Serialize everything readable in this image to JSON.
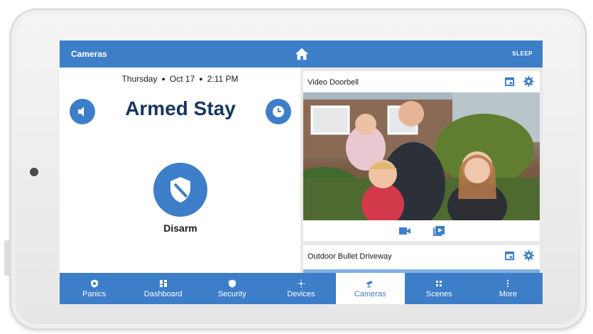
{
  "topbar": {
    "title": "Cameras",
    "sleep_label": "SLEEP"
  },
  "status": {
    "day": "Thursday",
    "date": "Oct 17",
    "time": "2:11 PM",
    "armed_state": "Armed Stay",
    "disarm_label": "Disarm"
  },
  "cameras": [
    {
      "name": "Video Doorbell"
    },
    {
      "name": "Outdoor Bullet Driveway"
    }
  ],
  "nav": {
    "items": [
      {
        "label": "Panics",
        "icon": "shield-panic-icon",
        "active": false
      },
      {
        "label": "Dashboard",
        "icon": "dashboard-grid-icon",
        "active": false
      },
      {
        "label": "Security",
        "icon": "shield-icon",
        "active": false
      },
      {
        "label": "Devices",
        "icon": "devices-icon",
        "active": false
      },
      {
        "label": "Cameras",
        "icon": "camera-icon",
        "active": true
      },
      {
        "label": "Scenes",
        "icon": "scenes-icon",
        "active": false
      },
      {
        "label": "More",
        "icon": "more-dots-icon",
        "active": false
      }
    ]
  },
  "colors": {
    "accent": "#3d7ec9",
    "status_text": "#17365d"
  }
}
